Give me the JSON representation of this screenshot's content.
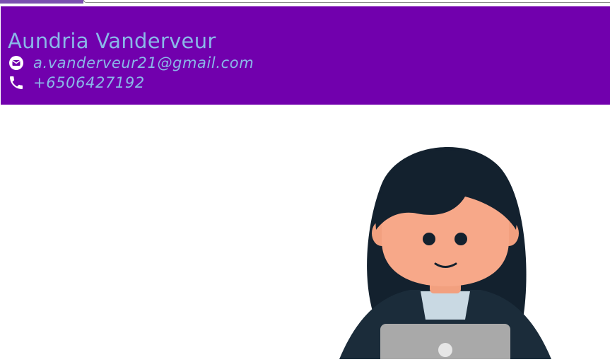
{
  "profile": {
    "name": "Aundria Vanderveur",
    "email": "a.vanderveur21@gmail.com",
    "phone": "+6506427192"
  },
  "icons": {
    "email": "email-icon",
    "phone": "phone-icon",
    "illustration": "person-with-laptop-illustration"
  },
  "colors": {
    "header_bg": "#7100ad",
    "header_text": "#8ab8e8"
  }
}
